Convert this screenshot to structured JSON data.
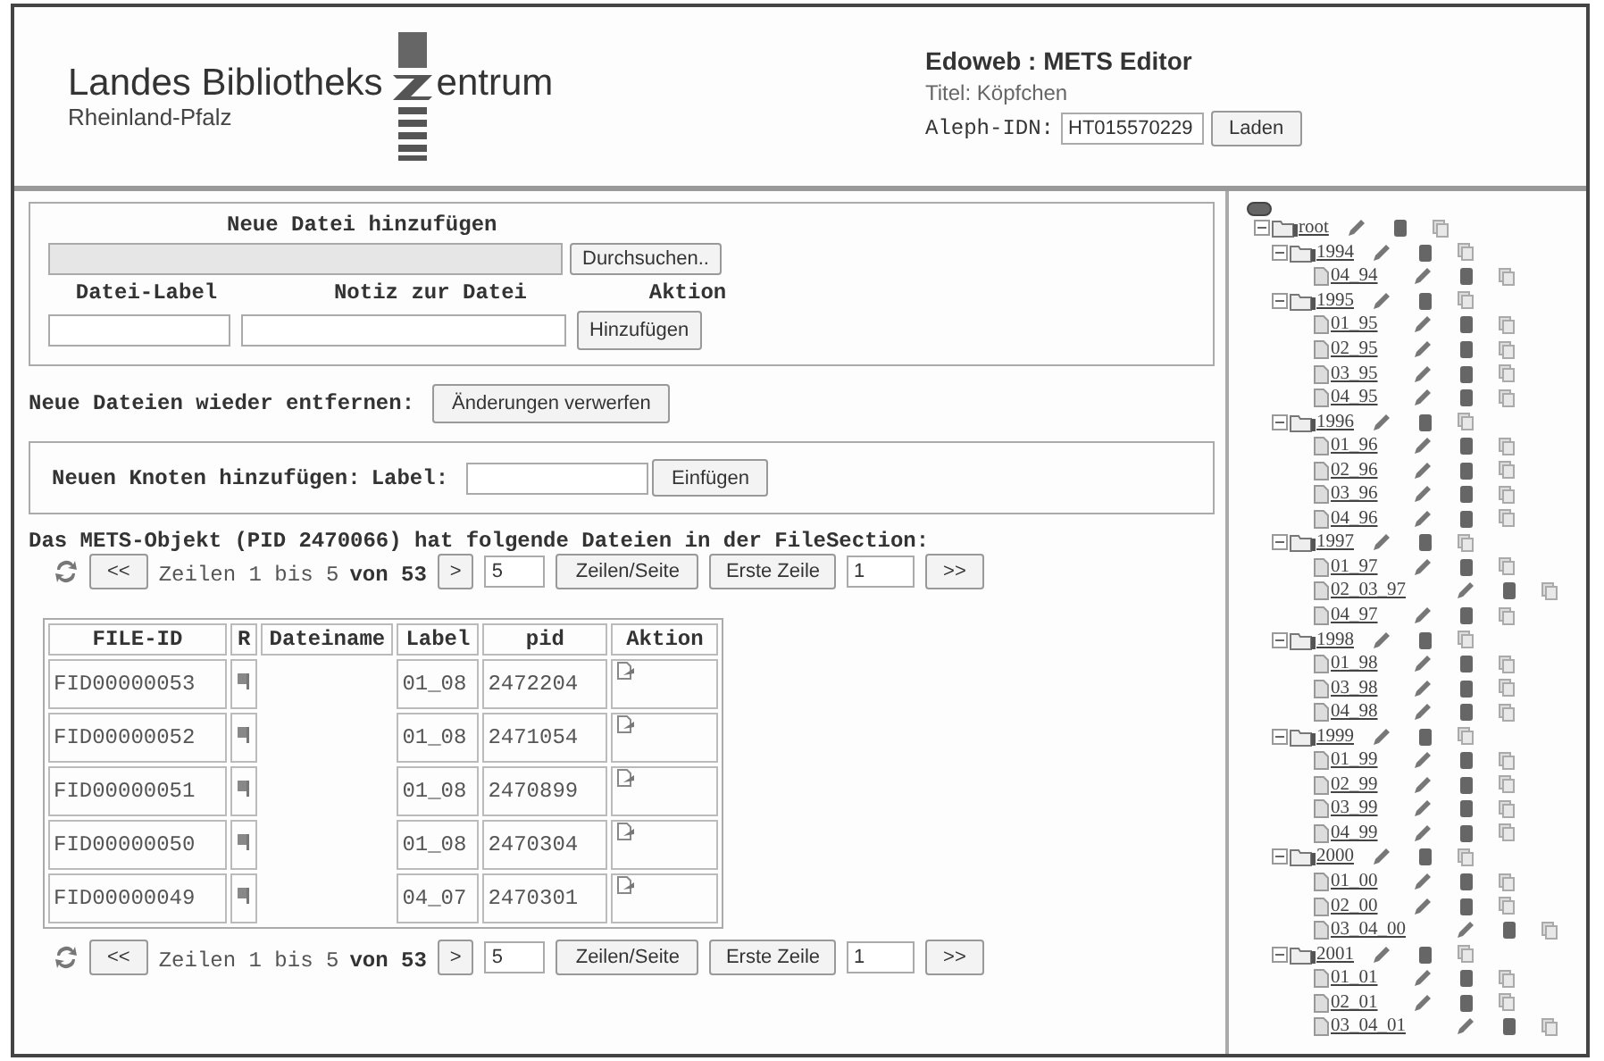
{
  "logo": {
    "name_left": "Landes Bibliotheks",
    "name_right": "entrum",
    "subtitle": "Rheinland-Pfalz"
  },
  "header": {
    "title": "Edoweb : METS Editor",
    "subtitle": "Titel: Köpfchen",
    "idn_label": "Aleph-IDN:",
    "idn_value": "HT015570229",
    "load_button": "Laden"
  },
  "add_file": {
    "title": "Neue Datei hinzufügen",
    "browse_button": "Durchsuchen..",
    "columns": [
      "Datei-Label",
      "Notiz zur Datei",
      "Aktion"
    ],
    "add_button": "Hinzufügen"
  },
  "discard": {
    "label": "Neue Dateien wieder entfernen:",
    "button": "Änderungen verwerfen"
  },
  "add_node": {
    "title": "Neuen Knoten hinzufügen:",
    "label": "Label:",
    "button": "Einfügen"
  },
  "file_section_title": "Das METS-Objekt (PID 2470066) hat folgende Dateien in der FileSection:",
  "pagers": [
    {
      "first": "<<",
      "text": "Zeilen 1 bis 5",
      "total": "von 53",
      "next": ">",
      "rows": "5",
      "rows_button": "Zeilen/Seite",
      "first_row_button": "Erste Zeile",
      "row": "1",
      "last": ">>"
    },
    {
      "first": "<<",
      "text": "Zeilen 1 bis 5",
      "total": "von 53",
      "next": ">",
      "rows": "5",
      "rows_button": "Zeilen/Seite",
      "first_row_button": "Erste Zeile",
      "row": "1",
      "last": ">>"
    }
  ],
  "table": {
    "columns": [
      "FILE-ID",
      "R",
      "Dateiname",
      "Label",
      "pid",
      "Aktion"
    ],
    "rows": [
      {
        "file_id": "FID00000053",
        "label": "01_08",
        "pid": "2472204"
      },
      {
        "file_id": "FID00000052",
        "label": "01_08",
        "pid": "2471054"
      },
      {
        "file_id": "FID00000051",
        "label": "01_08",
        "pid": "2470899"
      },
      {
        "file_id": "FID00000050",
        "label": "01_08",
        "pid": "2470304"
      },
      {
        "file_id": "FID00000049",
        "label": "04_07",
        "pid": "2470301"
      }
    ]
  },
  "tree": {
    "label": "root",
    "kind": "folder",
    "expanded": true,
    "children": [
      {
        "label": "1994",
        "kind": "folder",
        "expanded": true,
        "children": [
          {
            "label": "04_94",
            "kind": "file"
          }
        ]
      },
      {
        "label": "1995",
        "kind": "folder",
        "expanded": true,
        "children": [
          {
            "label": "01_95",
            "kind": "file"
          },
          {
            "label": "02_95",
            "kind": "file"
          },
          {
            "label": "03_95",
            "kind": "file"
          },
          {
            "label": "04_95",
            "kind": "file"
          }
        ]
      },
      {
        "label": "1996",
        "kind": "folder",
        "expanded": true,
        "children": [
          {
            "label": "01_96",
            "kind": "file"
          },
          {
            "label": "02_96",
            "kind": "file"
          },
          {
            "label": "03_96",
            "kind": "file"
          },
          {
            "label": "04_96",
            "kind": "file"
          }
        ]
      },
      {
        "label": "1997",
        "kind": "folder",
        "expanded": true,
        "children": [
          {
            "label": "01_97",
            "kind": "file"
          },
          {
            "label": "02_03_97",
            "kind": "file"
          },
          {
            "label": "04_97",
            "kind": "file"
          }
        ]
      },
      {
        "label": "1998",
        "kind": "folder",
        "expanded": true,
        "children": [
          {
            "label": "01_98",
            "kind": "file"
          },
          {
            "label": "03_98",
            "kind": "file"
          },
          {
            "label": "04_98",
            "kind": "file"
          }
        ]
      },
      {
        "label": "1999",
        "kind": "folder",
        "expanded": true,
        "children": [
          {
            "label": "01_99",
            "kind": "file"
          },
          {
            "label": "02_99",
            "kind": "file"
          },
          {
            "label": "03_99",
            "kind": "file"
          },
          {
            "label": "04_99",
            "kind": "file"
          }
        ]
      },
      {
        "label": "2000",
        "kind": "folder",
        "expanded": true,
        "children": [
          {
            "label": "01_00",
            "kind": "file"
          },
          {
            "label": "02_00",
            "kind": "file"
          },
          {
            "label": "03_04_00",
            "kind": "file"
          }
        ]
      },
      {
        "label": "2001",
        "kind": "folder",
        "expanded": true,
        "children": [
          {
            "label": "01_01",
            "kind": "file"
          },
          {
            "label": "02_01",
            "kind": "file"
          },
          {
            "label": "03_04_01",
            "kind": "file"
          }
        ]
      }
    ]
  }
}
